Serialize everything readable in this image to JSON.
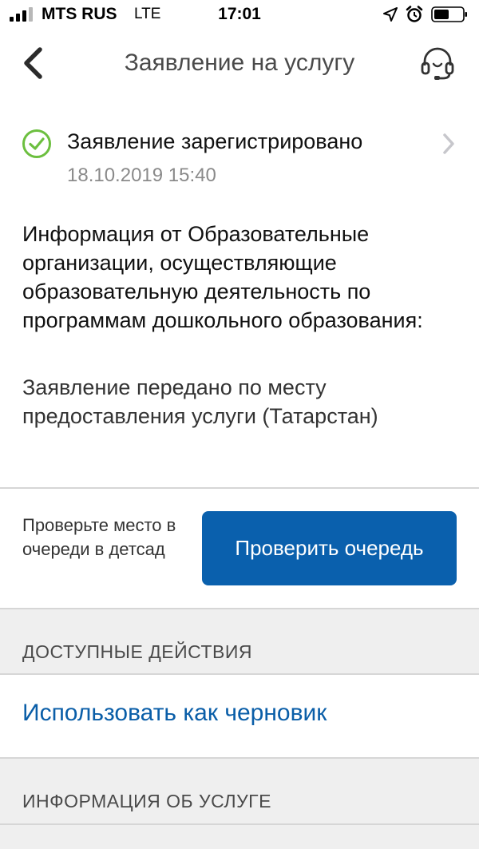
{
  "status_bar": {
    "carrier": "MTS RUS",
    "network": "LTE",
    "time": "17:01"
  },
  "nav": {
    "title": "Заявление на услугу",
    "back_icon": "chevron-left-icon",
    "support_icon": "headset-icon"
  },
  "application_status": {
    "title": "Заявление зарегистрировано",
    "date": "18.10.2019 15:40",
    "status_color": "#6cbf3f"
  },
  "info": {
    "title": "Информация от Образовательные организации, осуществляющие образовательную деятельность по программам дошкольного образования:",
    "body": "Заявление передано по месту предоставления услуги (Татарстан)"
  },
  "queue": {
    "hint": "Проверьте место в очереди в детсад",
    "button_label": "Проверить очередь",
    "button_color": "#0a60ad"
  },
  "actions": {
    "header": "ДОСТУПНЫЕ ДЕЙСТВИЯ",
    "items": [
      {
        "label": "Использовать как черновик"
      }
    ]
  },
  "service_info": {
    "header": "ИНФОРМАЦИЯ ОБ УСЛУГЕ"
  }
}
